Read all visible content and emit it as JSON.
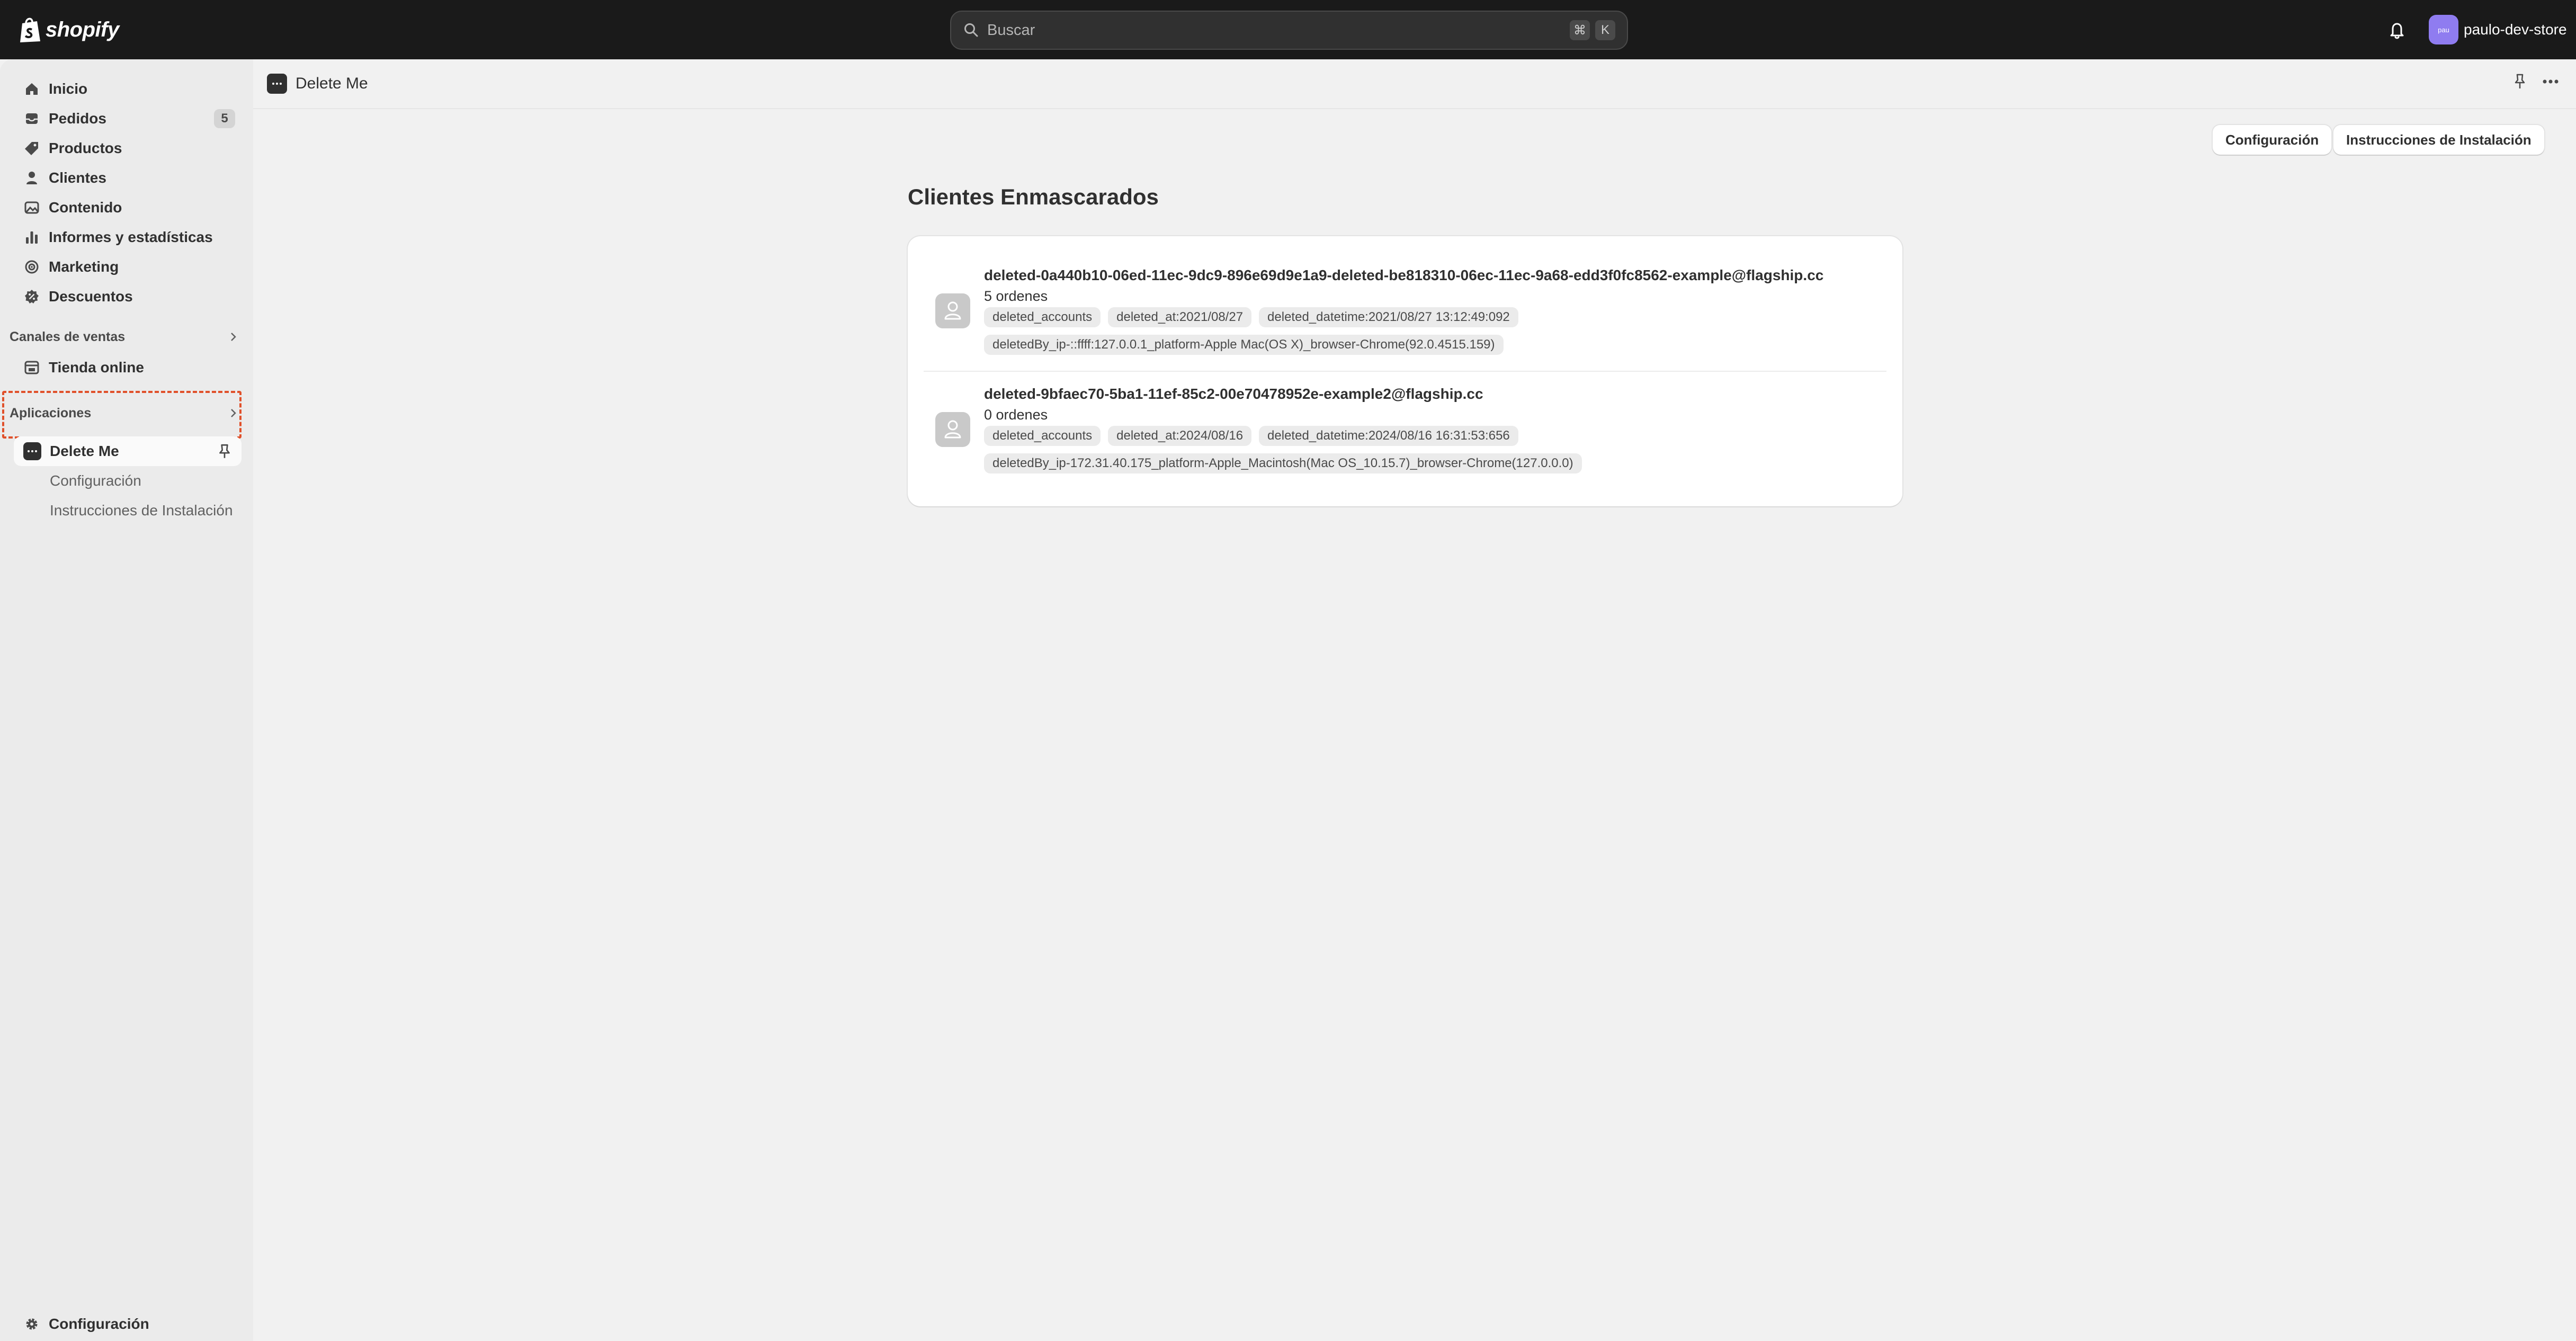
{
  "topbar": {
    "brand": "shopify",
    "search_placeholder": "Buscar",
    "shortcut_keys": [
      "⌘",
      "K"
    ],
    "store_avatar_text": "pau",
    "store_name": "paulo-dev-store"
  },
  "sidebar": {
    "items": [
      {
        "label": "Inicio",
        "icon": "home-icon"
      },
      {
        "label": "Pedidos",
        "icon": "orders-inbox-icon",
        "badge": "5"
      },
      {
        "label": "Productos",
        "icon": "product-tag-icon"
      },
      {
        "label": "Clientes",
        "icon": "person-icon"
      },
      {
        "label": "Contenido",
        "icon": "image-content-icon"
      },
      {
        "label": "Informes y estadísticas",
        "icon": "bar-chart-icon"
      },
      {
        "label": "Marketing",
        "icon": "target-icon"
      },
      {
        "label": "Descuentos",
        "icon": "discount-icon"
      }
    ],
    "sales_channels_heading": "Canales de ventas",
    "online_store_label": "Tienda online",
    "apps_heading": "Aplicaciones",
    "active_app_label": "Delete Me",
    "app_sub_items": [
      "Configuración",
      "Instrucciones de Instalación"
    ],
    "settings_label": "Configuración"
  },
  "main": {
    "app_title": "Delete Me",
    "buttons": {
      "config": "Configuración",
      "install": "Instrucciones de Instalación"
    },
    "section_title": "Clientes Enmascarados",
    "customers": [
      {
        "email": "deleted-0a440b10-06ed-11ec-9dc9-896e69d9e1a9-deleted-be818310-06ec-11ec-9a68-edd3f0fc8562-example@flagship.cc",
        "orders": "5 ordenes",
        "tags_row1": [
          "deleted_accounts",
          "deleted_at:2021/08/27",
          "deleted_datetime:2021/08/27 13:12:49:092"
        ],
        "tags_row2": [
          "deletedBy_ip-::ffff:127.0.0.1_platform-Apple Mac(OS X)_browser-Chrome(92.0.4515.159)"
        ]
      },
      {
        "email": "deleted-9bfaec70-5ba1-11ef-85c2-00e70478952e-example2@flagship.cc",
        "orders": "0 ordenes",
        "tags_row1": [
          "deleted_accounts",
          "deleted_at:2024/08/16",
          "deleted_datetime:2024/08/16 16:31:53:656"
        ],
        "tags_row2": [
          "deletedBy_ip-172.31.40.175_platform-Apple_Macintosh(Mac OS_10.15.7)_browser-Chrome(127.0.0.0)"
        ]
      }
    ]
  },
  "colors": {
    "topbar_bg": "#1a1a1a",
    "sidebar_bg": "#ebebeb",
    "main_bg": "#f1f1f1",
    "highlight_dash": "#e0502a",
    "avatar_purple": "#8f7cf0"
  }
}
